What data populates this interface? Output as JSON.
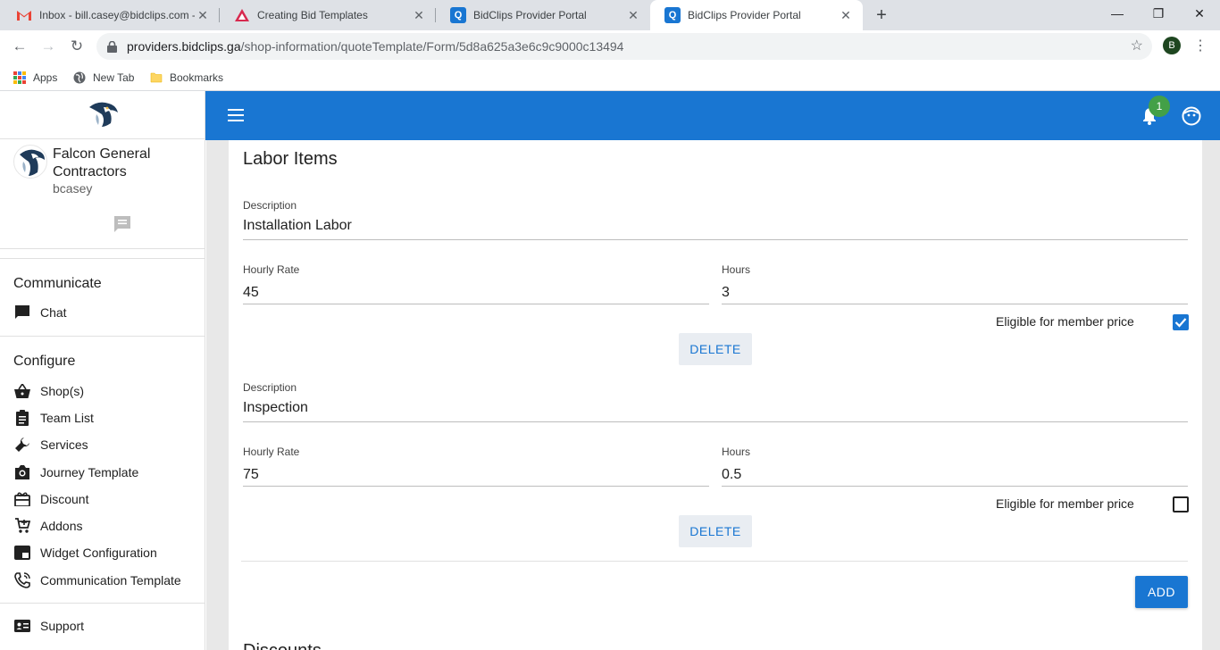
{
  "browser": {
    "tabs": [
      {
        "title": "Inbox - bill.casey@bidclips.com -",
        "icon": "gmail-icon"
      },
      {
        "title": "Creating Bid Templates",
        "icon": "docs-icon"
      },
      {
        "title": "BidClips Provider Portal",
        "icon": "bidclips-icon"
      },
      {
        "title": "BidClips Provider Portal",
        "icon": "bidclips-icon"
      }
    ],
    "url_host": "providers.bidclips.ga",
    "url_path": "/shop-information/quoteTemplate/Form/5d8a625a3e6c9c9000c13494",
    "profile_initial": "B",
    "bookmarks": [
      "Apps",
      "New Tab",
      "Bookmarks"
    ]
  },
  "sidebar": {
    "org_name": "Falcon General Contractors",
    "username": "bcasey",
    "sections": [
      {
        "title": "Communicate",
        "items": [
          {
            "label": "Chat",
            "icon": "chat-icon"
          }
        ]
      },
      {
        "title": "Configure",
        "items": [
          {
            "label": "Shop(s)",
            "icon": "basket-icon"
          },
          {
            "label": "Team List",
            "icon": "clipboard-icon"
          },
          {
            "label": "Services",
            "icon": "wrench-icon"
          },
          {
            "label": "Journey Template",
            "icon": "camera-icon"
          },
          {
            "label": "Discount",
            "icon": "gift-icon"
          },
          {
            "label": "Addons",
            "icon": "cart-add-icon"
          },
          {
            "label": "Widget Configuration",
            "icon": "widget-icon"
          },
          {
            "label": "Communication Template",
            "icon": "phone-icon"
          }
        ]
      }
    ],
    "support_label": "Support"
  },
  "appbar": {
    "notification_count": "1",
    "primary_color": "#1976d2"
  },
  "labor": {
    "title": "Labor Items",
    "description_label": "Description",
    "rate_label": "Hourly Rate",
    "hours_label": "Hours",
    "eligible_label": "Eligible for member price",
    "delete_label": "DELETE",
    "add_label": "ADD",
    "items": [
      {
        "description": "Installation Labor",
        "rate": "45",
        "hours": "3",
        "eligible": true
      },
      {
        "description": "Inspection",
        "rate": "75",
        "hours": "0.5",
        "eligible": false
      }
    ]
  },
  "next_section_title": "Discounts"
}
